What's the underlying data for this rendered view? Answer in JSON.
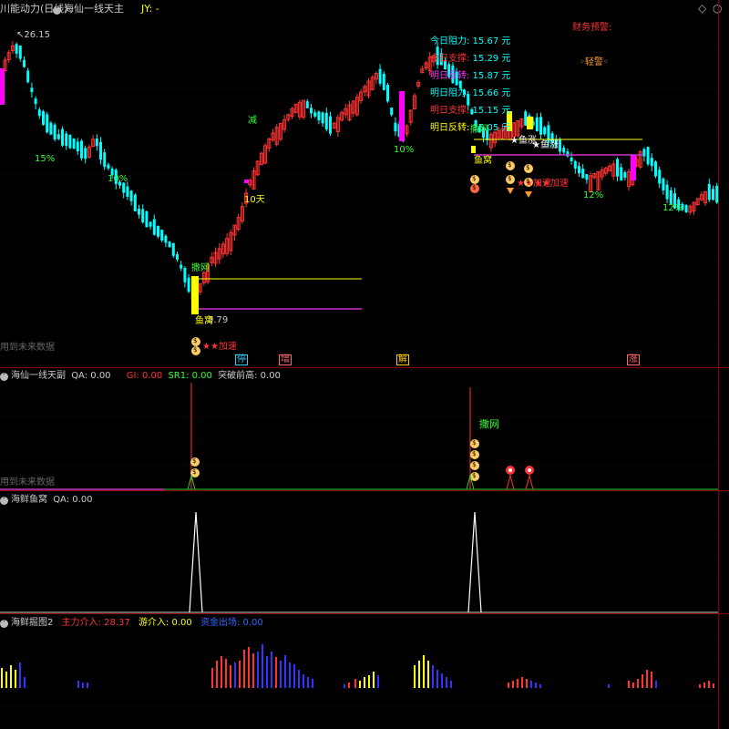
{
  "header": {
    "indicator1": "川能动力(日线)",
    "indicator2": "海仙一线天主",
    "jy_label": "JY: -",
    "corner_icons": [
      "diamond-icon",
      "circle-icon"
    ]
  },
  "main_pane": {
    "finance_alert": "财务预警:",
    "light_alert": "轻警",
    "info_labels": [
      {
        "label": "今日阻力:",
        "value": "15.67 元",
        "color": "#00ffff"
      },
      {
        "label": "今日支撑:",
        "value": "15.29 元",
        "color": "#ff3333"
      },
      {
        "label": "明日反转:",
        "value": "15.87 元",
        "color": "#ff33ff"
      },
      {
        "label": "明日阻力:",
        "value": "15.66 元",
        "color": "#00ffff"
      },
      {
        "label": "明日支撑:",
        "value": "15.15 元",
        "color": "#ff3333"
      },
      {
        "label": "明日反转:",
        "value": "15.05 元",
        "color": "#ffff00"
      }
    ],
    "high_price": "26.15",
    "low_price": "9.79",
    "future_data": "用到未来数据",
    "annotations": [
      {
        "text": "15%",
        "color": "#33ff33"
      },
      {
        "text": "10%",
        "color": "#33ff33"
      },
      {
        "text": "减",
        "color": "#33ff33"
      },
      {
        "text": "10天",
        "color": "#ffff00"
      },
      {
        "text": "撒网",
        "color": "#33ff33"
      },
      {
        "text": "鱼窝",
        "color": "#ffff00"
      },
      {
        "text": "★★加速",
        "color": "#ff3333"
      },
      {
        "text": "10%",
        "color": "#33ff33"
      },
      {
        "text": "撒网",
        "color": "#33ff33"
      },
      {
        "text": "鱼窝",
        "color": "#ffff00"
      },
      {
        "text": "★鱼涨",
        "color": "#ffffff"
      },
      {
        "text": "★鱼涨",
        "color": "#ffffff"
      },
      {
        "text": "★★加速",
        "color": "#ff3333"
      },
      {
        "text": "★★加速",
        "color": "#ff3333"
      },
      {
        "text": "12%",
        "color": "#33ff33"
      },
      {
        "text": "12%",
        "color": "#33ff33"
      }
    ],
    "bottom_tags": [
      {
        "text": "停",
        "color": "#33ccff"
      },
      {
        "text": "增",
        "color": "#ff6666"
      },
      {
        "text": "解",
        "color": "#ffcc00"
      },
      {
        "text": "涨",
        "color": "#ff6666"
      }
    ]
  },
  "pane2": {
    "title": "海仙一线天副",
    "qa": "QA: 0.00",
    "gi": "GI: 0.00",
    "sr1": "SR1: 0.00",
    "breakout": "突破前高: 0.00",
    "future_data": "用到未来数据",
    "net_label": "撒网"
  },
  "pane3": {
    "title": "海鲜鱼窝",
    "qa": "QA: 0.00"
  },
  "pane4": {
    "title": "海鲜掘图2",
    "main_entry": "主力介入: 28.37",
    "swim_entry": "游介入: 0.00",
    "gold_exit": "资金出场: 0.00",
    "main_color": "#ff3333",
    "swim_color": "#ffff00",
    "exit_color": "#3333ff"
  },
  "chart_data": {
    "type": "candlestick",
    "series_note": "daily candles (approximate); price range roughly 9.79–26.15",
    "price_high": 26.15,
    "price_low": 9.79,
    "up_color": "#ff3333",
    "down_color": "#00ffff",
    "special_magenta": "#ff00ff",
    "special_yellow": "#ffff00"
  }
}
